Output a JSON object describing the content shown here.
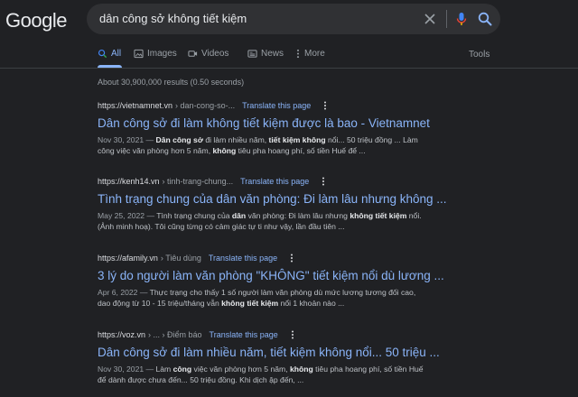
{
  "header": {
    "logo": "Google",
    "query": "dân công sở không tiết kiệm"
  },
  "tabs": [
    {
      "label": "All",
      "icon": "search-icon",
      "active": true
    },
    {
      "label": "Images",
      "icon": "image-icon",
      "active": false
    },
    {
      "label": "Videos",
      "icon": "video-icon",
      "active": false
    },
    {
      "label": "News",
      "icon": "news-icon",
      "active": false
    },
    {
      "label": "More",
      "icon": "more-vert-icon",
      "active": false
    }
  ],
  "tools_label": "Tools",
  "result_stats": "About 30,900,000 results (0.50 seconds)",
  "results": [
    {
      "domain": "https://vietnamnet.vn",
      "path": "› dan-cong-so-...",
      "translate": "Translate this page",
      "title": "Dân công sở đi làm không tiết kiệm được là bao - Vietnamnet",
      "snippet_line1": [
        {
          "t": "Nov 30, 2021 — ",
          "cls": "date"
        },
        {
          "t": "Dân công sở",
          "b": true
        },
        {
          "t": " đi làm nhiều năm, "
        },
        {
          "t": "tiết kiệm không",
          "b": true
        },
        {
          "t": " nổi... 50 triệu đồng ... Làm"
        }
      ],
      "snippet_line2": [
        {
          "t": "công việc văn phòng hơn 5 năm, "
        },
        {
          "t": "không",
          "b": true
        },
        {
          "t": " tiêu pha hoang phí, số tiền Huế để ..."
        }
      ]
    },
    {
      "domain": "https://kenh14.vn",
      "path": "› tinh-trang-chung...",
      "translate": "Translate this page",
      "title": "Tình trạng chung của dân văn phòng: Đi làm lâu nhưng không ...",
      "snippet_line1": [
        {
          "t": "May 25, 2022 — ",
          "cls": "date"
        },
        {
          "t": "Tình trạng chung của "
        },
        {
          "t": "dân",
          "b": true
        },
        {
          "t": " văn phòng: Đi làm lâu nhưng "
        },
        {
          "t": "không tiết kiệm",
          "b": true
        },
        {
          "t": " nổi."
        }
      ],
      "snippet_line2": [
        {
          "t": "(Ảnh minh hoạ). Tôi cũng từng có cảm giác tự ti như vậy, lần đầu tiên ..."
        }
      ]
    },
    {
      "domain": "https://afamily.vn",
      "path": "› Tiêu dùng",
      "translate": "Translate this page",
      "title": "3 lý do người làm văn phòng \"KHÔNG\" tiết kiệm nổi dù lương ...",
      "snippet_line1": [
        {
          "t": "Apr 6, 2022 — ",
          "cls": "date"
        },
        {
          "t": "Thực trạng cho thấy 1 số người làm văn phòng dù mức lương tương đối cao,"
        }
      ],
      "snippet_line2": [
        {
          "t": "dao động từ 10 - 15 triệu/tháng vẫn "
        },
        {
          "t": "không tiết kiệm",
          "b": true
        },
        {
          "t": " nổi 1 khoản nào ..."
        }
      ]
    },
    {
      "domain": "https://voz.vn",
      "path": "› ... › Điểm báo",
      "translate": "Translate this page",
      "title": "Dân công sở đi làm nhiều năm, tiết kiệm không nổi... 50 triệu ...",
      "snippet_line1": [
        {
          "t": "Nov 30, 2021 — ",
          "cls": "date"
        },
        {
          "t": "Làm "
        },
        {
          "t": "công",
          "b": true
        },
        {
          "t": " việc văn phòng hơn 5 năm, "
        },
        {
          "t": "không",
          "b": true
        },
        {
          "t": " tiêu pha hoang phí, số tiền Huế"
        }
      ],
      "snippet_line2": [
        {
          "t": "để dành được chưa đến... 50 triệu đồng. Khi dịch ập đến, ..."
        }
      ]
    }
  ]
}
